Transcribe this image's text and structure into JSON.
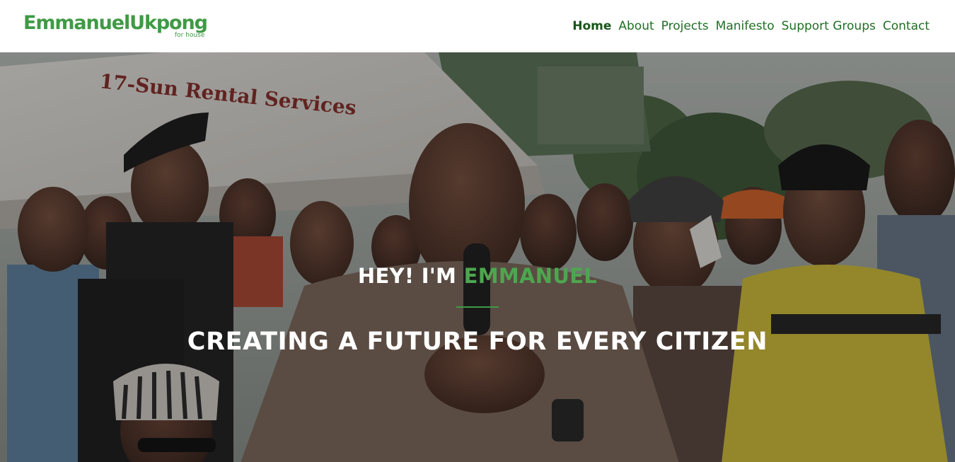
{
  "header": {
    "brand": {
      "name": "EmmanuelUkpong",
      "tagline": "for house"
    },
    "nav": [
      {
        "label": "Home",
        "active": true
      },
      {
        "label": "About",
        "active": false
      },
      {
        "label": "Projects",
        "active": false
      },
      {
        "label": "Manifesto",
        "active": false
      },
      {
        "label": "Support Groups",
        "active": false
      },
      {
        "label": "Contact",
        "active": false
      }
    ]
  },
  "hero": {
    "greeting_prefix": "HEY! I'M ",
    "greeting_name": "EMMANUEL",
    "headline": "CREATING A FUTURE FOR EVERY CITIZEN",
    "background_sign_text": "17-Sun Rental Services"
  },
  "colors": {
    "brand_green": "#3f9a45",
    "nav_green": "#1f6f24",
    "accent_green": "#4da64f"
  }
}
